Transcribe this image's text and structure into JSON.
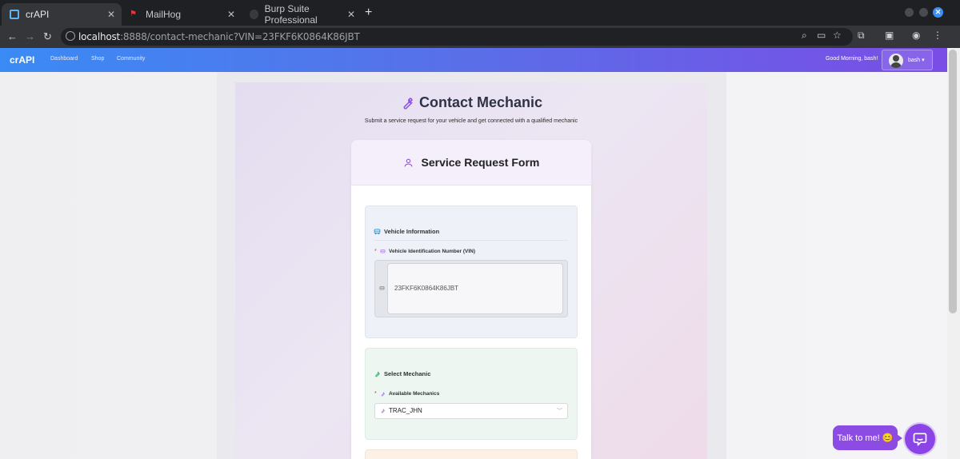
{
  "browser": {
    "tabs": [
      {
        "title": "crAPI",
        "active": true
      },
      {
        "title": "MailHog",
        "active": false
      },
      {
        "title": "Burp Suite Professional",
        "active": false
      }
    ],
    "url_host": "localhost",
    "url_rest": ":8888/contact-mechanic?VIN=23FKF6K0864K86JBT"
  },
  "app": {
    "brand": "crAPI",
    "nav": [
      "Dashboard",
      "Shop",
      "Community"
    ],
    "greeting": "Good Morning, bash!",
    "username": "bash ▾",
    "accent": "#7a4de6"
  },
  "page": {
    "title": "Contact Mechanic",
    "subtitle": "Submit a service request for your vehicle and get connected with a qualified mechanic",
    "form_title": "Service Request Form",
    "vehicle_section": {
      "title": "Vehicle Information",
      "vin_label": "Vehicle Identification Number (VIN)",
      "vin_value": "23FKF6K0864K86JBT"
    },
    "mechanic_section": {
      "title": "Select Mechanic",
      "label": "Available Mechanics",
      "selected": "TRAC_JHN"
    },
    "required_mark": "*"
  },
  "chat": {
    "bubble_text": "Talk to me! 😊"
  }
}
